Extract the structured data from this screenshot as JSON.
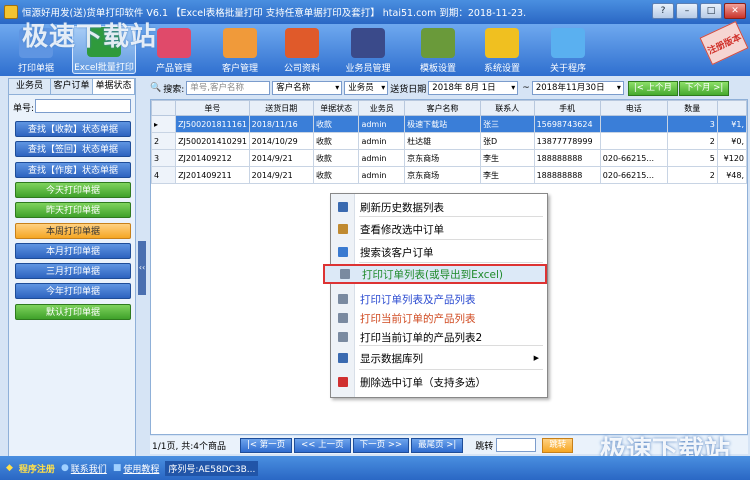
{
  "window": {
    "title": "恒源好用发(送)货单打印软件 V6.1 【Excel表格批量打印 支持任意单据打印及套打】 htai51.com 到期：2018-11-23.",
    "watermark": "极速下载站",
    "reg_badge": "注册版本"
  },
  "toolbar": [
    {
      "label": "打印单据",
      "color": "#5f95e2"
    },
    {
      "label": "Excel批量打印",
      "color": "#2f9a3c"
    },
    {
      "label": "产品管理",
      "color": "#e04a6a"
    },
    {
      "label": "客户管理",
      "color": "#f09a3a"
    },
    {
      "label": "公司资料",
      "color": "#e05a2a"
    },
    {
      "label": "业务员管理",
      "color": "#3a4a8a"
    },
    {
      "label": "模板设置",
      "color": "#6a9a3a"
    },
    {
      "label": "系统设置",
      "color": "#f0c020"
    },
    {
      "label": "关于程序",
      "color": "#5ab0f0"
    }
  ],
  "left_panel": {
    "tabs": [
      "业务员",
      "客户订单",
      "单据状态"
    ],
    "order_label": "单号:",
    "buttons": [
      {
        "label": "查找【收款】状态单据",
        "style": "blue"
      },
      {
        "label": "查找【签回】状态单据",
        "style": "blue"
      },
      {
        "label": "查找【作废】状态单据",
        "style": "blue"
      },
      {
        "label": "今天打印单据",
        "style": "green"
      },
      {
        "label": "昨天打印单据",
        "style": "green"
      },
      {
        "label": "本周打印单据",
        "style": "orange"
      },
      {
        "label": "本月打印单据",
        "style": "blue"
      },
      {
        "label": "三月打印单据",
        "style": "blue"
      },
      {
        "label": "今年打印单据",
        "style": "blue"
      },
      {
        "label": "默认打印单据",
        "style": "green"
      }
    ]
  },
  "search": {
    "label": "搜索:",
    "placeholder": "单号,客户名称",
    "field_select": "客户名称",
    "staff_select": "业务员",
    "date_label": "送货日期",
    "date_from": "2018年 8月 1日",
    "date_sep": "~",
    "date_to": "2018年11月30日",
    "prev_month": "上个月",
    "next_month": "下个月"
  },
  "grid": {
    "columns": [
      "单号",
      "送货日期",
      "单据状态",
      "业务员",
      "客户名称",
      "联系人",
      "手机",
      "电话",
      "数量",
      ""
    ],
    "rows": [
      {
        "idx": "▸",
        "cells": [
          "ZJ500201811161",
          "2018/11/16",
          "收款",
          "admin",
          "极速下载站",
          "张三",
          "15698743624",
          "",
          "3",
          "¥1,"
        ]
      },
      {
        "idx": "2",
        "cells": [
          "ZJ500201410291",
          "2014/10/29",
          "收款",
          "admin",
          "杜达雄",
          "张D",
          "13877778999",
          "",
          "2",
          "¥0,"
        ]
      },
      {
        "idx": "3",
        "cells": [
          "ZJ201409212",
          "2014/9/21",
          "收款",
          "admin",
          "京东商场",
          "李生",
          "188888888",
          "020-66215...",
          "5",
          "¥120"
        ]
      },
      {
        "idx": "4",
        "cells": [
          "ZJ201409211",
          "2014/9/21",
          "收款",
          "admin",
          "京东商场",
          "李生",
          "188888888",
          "020-66215...",
          "2",
          "¥48,"
        ]
      }
    ]
  },
  "context_menu": [
    {
      "label": "刷新历史数据列表",
      "icon_color": "#3a6ab0"
    },
    {
      "label": "查看修改选中订单",
      "icon_color": "#c08a30"
    },
    {
      "label": "搜索该客户订单",
      "icon_color": "#3a7ad0"
    },
    {
      "label": "打印订单列表(或导出到Excel)",
      "icon_color": "#7a8aa0",
      "color": "#1e8a2a"
    },
    {
      "label": "打印订单列表及产品列表",
      "icon_color": "#7a8aa0",
      "color": "#2a4ad0"
    },
    {
      "label": "打印当前订单的产品列表",
      "icon_color": "#7a8aa0",
      "color": "#d04a20"
    },
    {
      "label": "打印当前订单的产品列表2",
      "icon_color": "#7a8aa0",
      "color": "#000000"
    },
    {
      "label": "显示数据库列",
      "icon_color": "#3a6ab0"
    },
    {
      "label": "删除选中订单（支持多选）",
      "icon_color": "#d03030"
    }
  ],
  "status": {
    "page_info": "1/1页, 共:4个商品",
    "first": "|< 第一页",
    "prev": "<< 上一页",
    "next": "下一页 >>",
    "last": "最尾页 >|",
    "jump_label": "跳转",
    "jump_btn": "跳转"
  },
  "footer": {
    "register": "程序注册",
    "contact": "联系我们",
    "tutorial": "使用教程",
    "serial": "序列号:AE58DC3B..."
  }
}
